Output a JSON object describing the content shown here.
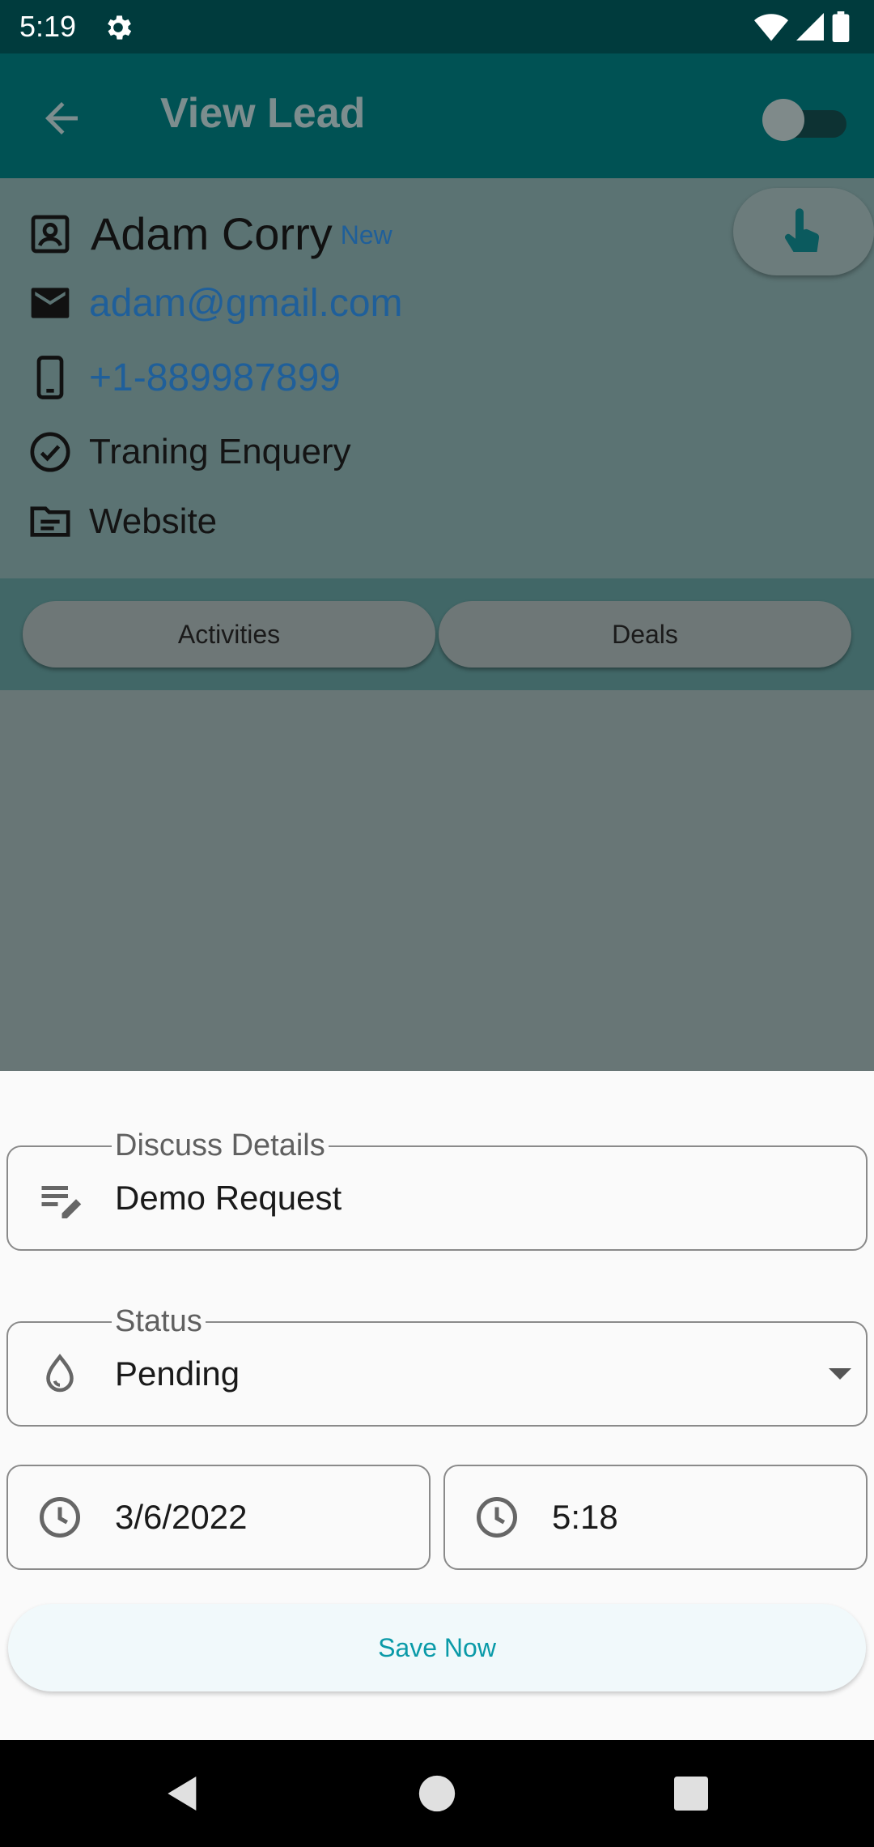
{
  "status_bar": {
    "time": "5:19"
  },
  "app_bar": {
    "title": "View Lead"
  },
  "lead": {
    "name": "Adam Corry",
    "status_badge": "New",
    "email": "adam@gmail.com",
    "phone": "+1-889987899",
    "purpose": "Traning Enquery",
    "source": "Website"
  },
  "tabs": [
    {
      "label": "Activities"
    },
    {
      "label": "Deals"
    }
  ],
  "form": {
    "discuss": {
      "label": "Discuss Details",
      "value": "Demo Request"
    },
    "status": {
      "label": "Status",
      "value": "Pending"
    },
    "date": {
      "value": "3/6/2022"
    },
    "time": {
      "value": "5:18"
    },
    "save_label": "Save Now"
  },
  "colors": {
    "accent": "#0a9aa8",
    "app_bar": "#005254",
    "link": "#1f5f9a"
  }
}
